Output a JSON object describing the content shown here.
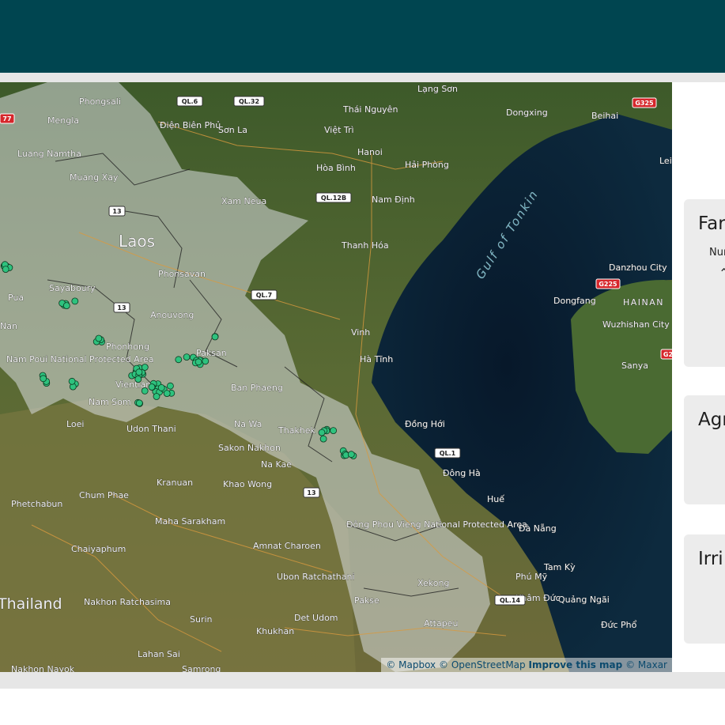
{
  "map": {
    "country_labels": [
      "Laos",
      "Thailand"
    ],
    "sea_label": "Gulf of Tonkin",
    "region_labels": [
      "HAINAN"
    ],
    "cities": [
      "Phongsali",
      "Mengla",
      "Điện Biên Phủ",
      "Sơn La",
      "Thái Nguyên",
      "Lạng Sơn",
      "Dongxing",
      "Beihai",
      "Việt Trì",
      "Hanoi",
      "Hải Phòng",
      "Hòa Bình",
      "Nam Định",
      "Luang Namtha",
      "Muang Xay",
      "Xam Neua",
      "Thanh Hóa",
      "Phonsavan",
      "Sayaboury",
      "Danzhou City",
      "Dongfang",
      "Wuzhishan City",
      "Sanya",
      "Anouvong",
      "Vinh",
      "Phonhong",
      "Paksan",
      "Hà Tĩnh",
      "Nam Poui National Protected Area",
      "Vientiane",
      "Ban Phaeng",
      "Nam Som",
      "Loei",
      "Udon Thani",
      "Na Wa",
      "Thakhek",
      "Đồng Hới",
      "Sakon Nakhon",
      "Na Kae",
      "Kranuan",
      "Khao Wong",
      "Đông Hà",
      "Chum Phae",
      "Huế",
      "Phetchabun",
      "Maha Sarakham",
      "Đông Phou Vieng National Protected Area",
      "Amnat Charoen",
      "Đà Nẵng",
      "Chaiyaphum",
      "Ubon Ratchathani",
      "Xekong",
      "Tam Kỳ",
      "Nakhon Ratchasima",
      "Surin",
      "Det Udom",
      "Pakse",
      "Quảng Ngãi",
      "Khukhan",
      "Attapeu",
      "Đức Phổ",
      "Lahan Sai",
      "Nakhon Nayok",
      "Phú Mỹ",
      "Khâm Đức",
      "Samrong",
      "Pua",
      "Nan",
      "Lei"
    ],
    "road_shields": [
      "QL.6",
      "QL.32",
      "QL.12B",
      "13",
      "13",
      "QL.7",
      "QL.1",
      "13",
      "QL.14"
    ],
    "red_shields": [
      "G325",
      "G225",
      "77",
      "G2"
    ],
    "attribution": {
      "mapbox": "© Mapbox",
      "osm": "© OpenStreetMap",
      "improve": "Improve this map",
      "maxar": "© Maxar"
    }
  },
  "panel": {
    "card1_title": "Far",
    "card1_sub": "Nur",
    "card1_caret": "⌃",
    "card2_title": "Agr",
    "card3_title": "Irri"
  },
  "colors": {
    "header": "#004550",
    "marker": "#2ec27e",
    "laos_overlay": "#d8dde0"
  }
}
